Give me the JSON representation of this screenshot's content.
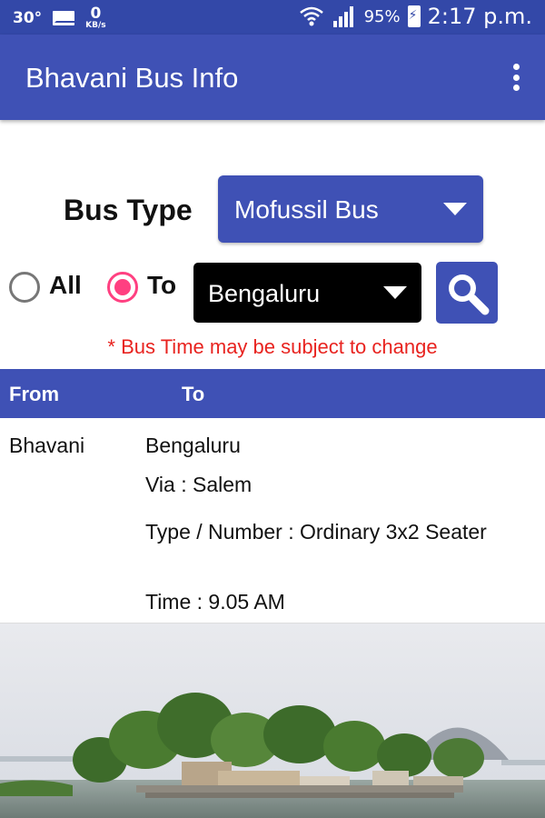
{
  "status_bar": {
    "temperature": "30°",
    "data_speed_value": "0",
    "data_speed_unit": "KB/s",
    "battery": "95%",
    "time": "2:17 p.m."
  },
  "app_bar": {
    "title": "Bhavani Bus Info",
    "overflow_icon": "more-vert-icon"
  },
  "filters": {
    "bus_type_label": "Bus Type",
    "bus_type_value": "Mofussil Bus",
    "radio_all_label": "All",
    "radio_to_label": "To",
    "radio_selected": "To",
    "destination_value": "Bengaluru",
    "search_icon": "search-icon"
  },
  "notice": "* Bus Time may be subject to change",
  "table": {
    "headers": {
      "from": "From",
      "to": "To"
    },
    "rows": [
      {
        "from": "Bhavani",
        "to": "Bengaluru",
        "via": "Via : Salem",
        "type": "Type / Number :  Ordinary 3x2 Seater",
        "time": "Time : 9.05 AM"
      }
    ]
  },
  "colors": {
    "primary": "#3f51b5",
    "status_bar": "#3348a8",
    "accent": "#ff4081",
    "notice": "#e8231f"
  }
}
